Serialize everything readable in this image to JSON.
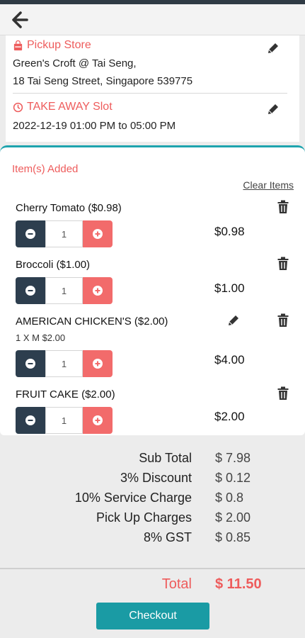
{
  "header": {
    "back_icon": "arrow-left-icon"
  },
  "pickup": {
    "title": "Pickup Store",
    "icon": "shopping-bag-icon",
    "line1": "Green's Croft @ Tai Seng,",
    "line2": "18 Tai Seng Street, Singapore 539775"
  },
  "slot": {
    "title": "TAKE AWAY Slot",
    "icon": "clock-icon",
    "value": "2022-12-19 01:00 PM to 05:00 PM"
  },
  "items_section": {
    "title": "Item(s) Added",
    "clear_label": "Clear Items",
    "items": [
      {
        "name": "Cherry Tomato ($0.98)",
        "detail": "",
        "qty": "1",
        "price": "$0.98",
        "editable": false
      },
      {
        "name": "Broccoli ($1.00)",
        "detail": "",
        "qty": "1",
        "price": "$1.00",
        "editable": false
      },
      {
        "name": "AMERICAN CHICKEN'S ($2.00)",
        "detail": "1 X M $2.00",
        "qty": "1",
        "price": "$4.00",
        "editable": true
      },
      {
        "name": "FRUIT CAKE ($2.00)",
        "detail": "",
        "qty": "1",
        "price": "$2.00",
        "editable": false
      }
    ]
  },
  "summary": [
    {
      "label": "Sub Total",
      "value": "$ 7.98"
    },
    {
      "label": "3% Discount",
      "value": "$ 0.12"
    },
    {
      "label": "10% Service Charge",
      "value": "$ 0.8"
    },
    {
      "label": "Pick Up Charges",
      "value": "$ 2.00"
    },
    {
      "label": "8% GST",
      "value": "$ 0.85"
    }
  ],
  "total": {
    "label": "Total",
    "value": "$ 11.50"
  },
  "checkout_label": "Checkout",
  "colors": {
    "accent_red": "#ee5c5c",
    "teal": "#1a9ba4",
    "dark_navy": "#2d3e4e"
  }
}
